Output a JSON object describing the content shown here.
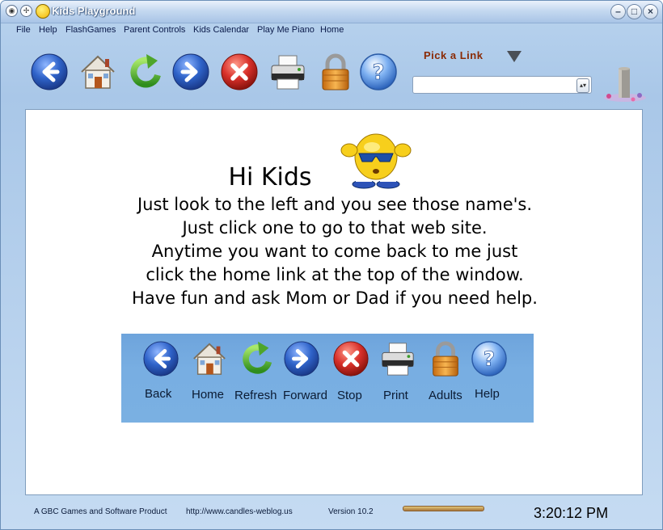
{
  "window": {
    "title": "Kids Playground"
  },
  "menu": [
    "File",
    "Help",
    "FlashGames",
    "Parent Controls",
    "Kids Calendar",
    "Play Me Piano",
    "Home"
  ],
  "toolbar": {
    "buttons": [
      "back-icon",
      "home-icon",
      "refresh-icon",
      "forward-icon",
      "stop-icon",
      "print-icon",
      "lock-icon",
      "help-icon"
    ],
    "pick_label": "Pick a Link",
    "link_value": ""
  },
  "content": {
    "greeting": "Hi Kids",
    "lines": [
      "Just look to the left and you see those name's.",
      "Just click one to go to that web site.",
      "Anytime you want to come back to me just",
      "click the home link at the top of the window.",
      "Have fun and ask Mom or Dad if you need help."
    ],
    "panel_labels": [
      "Back",
      "Home",
      "Refresh",
      "Forward",
      "Stop",
      "Print",
      "Adults",
      "Help"
    ]
  },
  "status": {
    "product": "A GBC Games and Software Product",
    "url": "http://www.candles-weblog.us",
    "version": "Version 10.2",
    "time": "3:20:12 PM"
  },
  "colors": {
    "accent_blue": "#2f63c9",
    "stop_red": "#d8302a",
    "pick_label": "#8a2a05",
    "panel_bg": "#78aee2"
  }
}
